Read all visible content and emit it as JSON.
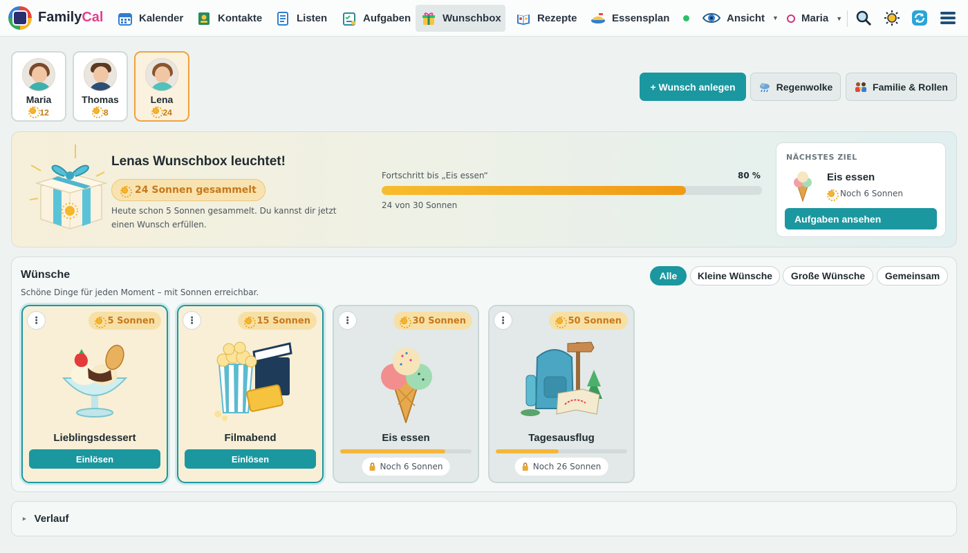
{
  "brand": {
    "name_a": "Family",
    "name_b": "Cal"
  },
  "nav": {
    "items": [
      {
        "label": "Kalender",
        "icon": "calendar-icon"
      },
      {
        "label": "Kontakte",
        "icon": "contacts-icon"
      },
      {
        "label": "Listen",
        "icon": "list-icon"
      },
      {
        "label": "Aufgaben",
        "icon": "tasks-icon"
      },
      {
        "label": "Wunschbox",
        "icon": "gift-icon"
      },
      {
        "label": "Rezepte",
        "icon": "recipe-book-icon"
      },
      {
        "label": "Essensplan",
        "icon": "meal-plan-icon"
      }
    ],
    "active": "Wunschbox",
    "view_label": "Ansicht",
    "user_label": "Maria",
    "colors": {
      "accent": "#1b97a0",
      "active_bg": "#e2e8e8"
    }
  },
  "profiles": [
    {
      "name": "Maria",
      "score": "12"
    },
    {
      "name": "Thomas",
      "score": "8"
    },
    {
      "name": "Lena",
      "score": "24"
    }
  ],
  "actions": {
    "add_wish": "+ Wunsch anlegen",
    "rain_cloud": "Regenwolke",
    "family_roles": "Familie & Rollen"
  },
  "banner": {
    "title": "Lenas Wunschbox leuchtet!",
    "badge": "24 Sonnen gesammelt",
    "text": "Heute schon 5 Sonnen gesammelt. Du kannst dir jetzt einen Wunsch erfüllen.",
    "progress_label": "Fortschritt bis „Eis essen“",
    "progress_pct_label": "80 %",
    "progress_fraction": 0.8,
    "progress_sub": "24 von 30 Sonnen",
    "next": {
      "heading": "NÄCHSTES ZIEL",
      "name": "Eis essen",
      "need": "Noch 6 Sonnen",
      "button": "Aufgaben ansehen"
    }
  },
  "wishes": {
    "title": "Wünsche",
    "subtitle": "Schöne Dinge für jeden Moment – mit Sonnen erreichbar.",
    "filters": [
      "Alle",
      "Kleine Wünsche",
      "Große Wünsche",
      "Gemeinsam"
    ],
    "active_filter": "Alle",
    "redeem_label": "Einlösen",
    "cards": [
      {
        "title": "Lieblingsdessert",
        "cost": "5 Sonnen",
        "state": "ready",
        "art": "sundae-icon"
      },
      {
        "title": "Filmabend",
        "cost": "15 Sonnen",
        "state": "ready",
        "art": "popcorn-icon"
      },
      {
        "title": "Eis essen",
        "cost": "30 Sonnen",
        "state": "locked",
        "progress": 0.8,
        "need": "Noch 6 Sonnen",
        "art": "ice-cream-icon"
      },
      {
        "title": "Tagesausflug",
        "cost": "50 Sonnen",
        "state": "locked",
        "progress": 0.48,
        "need": "Noch 26 Sonnen",
        "art": "backpack-icon"
      }
    ]
  },
  "history": {
    "label": "Verlauf"
  }
}
